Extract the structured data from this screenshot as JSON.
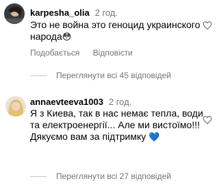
{
  "comments": [
    {
      "username": "karpesha_olia",
      "time": "2 год.",
      "text_lines": [
        "Это не война это геноцид украинского",
        "народа"
      ],
      "emoji": "😳",
      "like_label": "Подобається",
      "reply_label": "Відповісти",
      "view_replies": "Переглянути всі 45 відповідей"
    },
    {
      "username": "annaevteeva1003",
      "time": "2 год.",
      "text_lines": [
        "Я з Киева, так в нас немає тепла, води",
        "та електроенергії... Але ми вистоїмо!!!",
        "Дякуємо вам за підтримку"
      ],
      "emoji": "💙",
      "view_replies": "Переглянути всі 27 відповідей"
    }
  ],
  "icons": {
    "like": "heart-outline-icon"
  },
  "colors": {
    "secondary_text": "#737373",
    "blue_heart": "#3b82f6"
  }
}
